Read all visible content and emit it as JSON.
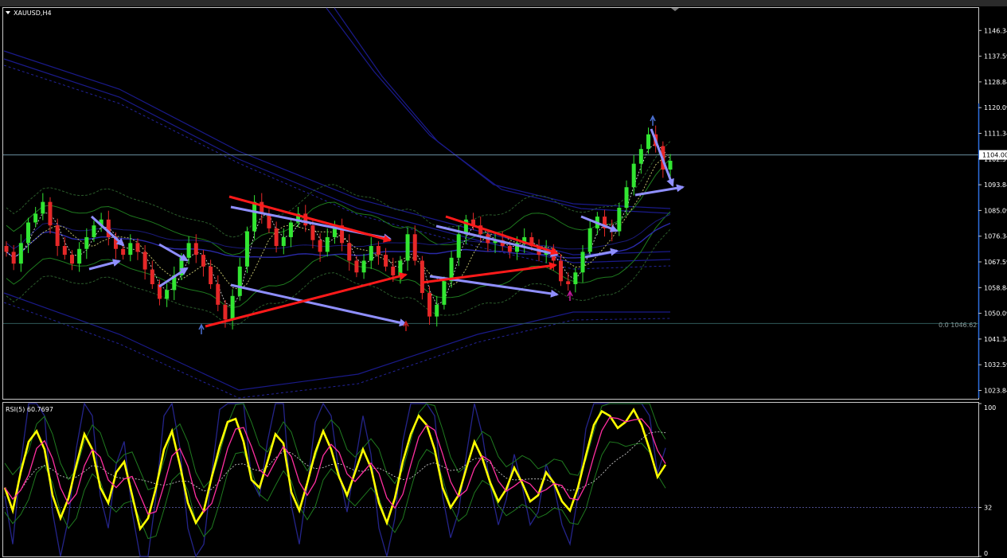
{
  "window": {
    "symbol_label": "XAUUSD,H4"
  },
  "chart_data": [
    {
      "type": "candlestick",
      "symbol": "XAUUSD",
      "timeframe": "H4",
      "title": "XAUUSD,H4",
      "ylim": [
        1021.0,
        1154.0
      ],
      "y_ticks": [
        "1146.34",
        "1137.59",
        "1128.84",
        "1120.09",
        "1111.34",
        "1102.59",
        "1093.84",
        "1085.09",
        "1076.34",
        "1067.59",
        "1058.84",
        "1050.09",
        "1041.34",
        "1032.59",
        "1023.84"
      ],
      "current_price": "1104.00",
      "level_label": "0.0 1046.62",
      "level_value": 1046.62,
      "series": [
        {
          "name": "close",
          "values": [
            1071,
            1067,
            1074,
            1081,
            1084,
            1088,
            1080,
            1073,
            1070,
            1067,
            1072,
            1076,
            1080,
            1082,
            1076,
            1072,
            1070,
            1074,
            1071,
            1065,
            1060,
            1055,
            1058,
            1063,
            1069,
            1074,
            1070,
            1066,
            1060,
            1053,
            1048,
            1056,
            1066,
            1078,
            1088,
            1084,
            1079,
            1073,
            1076,
            1081,
            1084,
            1080,
            1075,
            1071,
            1076,
            1080,
            1074,
            1068,
            1064,
            1068,
            1073,
            1070,
            1066,
            1063,
            1068,
            1077,
            1068,
            1057,
            1049,
            1053,
            1061,
            1069,
            1077,
            1082,
            1080,
            1077,
            1074,
            1075,
            1073,
            1071,
            1074,
            1076,
            1073,
            1070,
            1072,
            1068,
            1061,
            1060,
            1064,
            1071,
            1079,
            1083,
            1079,
            1078,
            1086,
            1093,
            1101,
            1106,
            1111,
            1107,
            1099,
            1102
          ]
        }
      ],
      "indicators": [
        "moving averages",
        "envelope bands"
      ]
    },
    {
      "type": "line",
      "title": "RSI(5) 60.7697",
      "ylim": [
        0,
        100
      ],
      "y_ticks": [
        "100",
        "32",
        "0"
      ],
      "level": 32,
      "series": [
        {
          "name": "RSI(5)",
          "values": [
            45,
            30,
            55,
            75,
            82,
            70,
            40,
            25,
            38,
            60,
            80,
            70,
            45,
            35,
            55,
            62,
            40,
            18,
            25,
            45,
            70,
            82,
            60,
            35,
            22,
            30,
            52,
            72,
            88,
            90,
            75,
            50,
            45,
            62,
            80,
            74,
            42,
            30,
            48,
            68,
            82,
            70,
            52,
            40,
            55,
            70,
            58,
            35,
            22,
            38,
            62,
            80,
            92,
            86,
            70,
            45,
            32,
            40,
            58,
            75,
            64,
            48,
            36,
            44,
            58,
            48,
            36,
            40,
            55,
            48,
            36,
            30,
            45,
            66,
            86,
            95,
            92,
            84,
            88,
            96,
            86,
            70,
            52,
            60
          ]
        }
      ]
    }
  ]
}
